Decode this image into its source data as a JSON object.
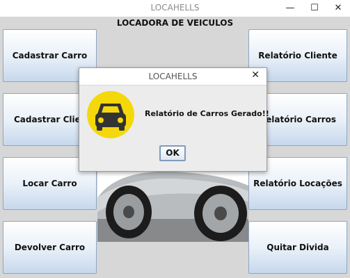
{
  "window": {
    "title": "LOCAHELLS",
    "minimize_glyph": "—",
    "maximize_glyph": "☐",
    "close_glyph": "✕"
  },
  "main": {
    "heading": "LOCADORA DE VEICULOS",
    "left_buttons": [
      "Cadastrar Carro",
      "Cadastrar Cliente",
      "Locar Carro",
      "Devolver Carro"
    ],
    "right_buttons": [
      "Relatório Cliente",
      "Relatório Carros",
      "Relatório Locações",
      "Quitar Divida"
    ],
    "background_image": "car-wheel-image"
  },
  "dialog": {
    "title": "LOCAHELLS",
    "close_glyph": "✕",
    "icon": "car-icon",
    "icon_color": "#f5d80c",
    "message": "Relatório de Carros Gerado!!",
    "ok_label": "OK"
  }
}
